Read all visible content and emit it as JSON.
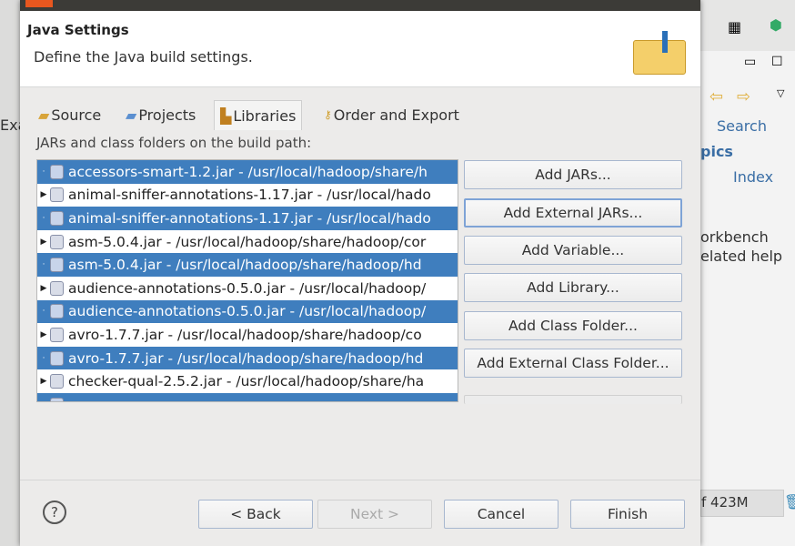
{
  "header": {
    "title": "Java Settings",
    "subtitle": "Define the Java build settings."
  },
  "tabs": [
    {
      "label": "Source"
    },
    {
      "label": "Projects"
    },
    {
      "label": "Libraries",
      "selected": true
    },
    {
      "label": "Order and Export"
    }
  ],
  "list_label": "JARs and class folders on the build path:",
  "entries": [
    {
      "text": "accessors-smart-1.2.jar - /usr/local/hadoop/share/h",
      "selected": true
    },
    {
      "text": "animal-sniffer-annotations-1.17.jar - /usr/local/hado",
      "selected": false
    },
    {
      "text": "animal-sniffer-annotations-1.17.jar - /usr/local/hado",
      "selected": true
    },
    {
      "text": "asm-5.0.4.jar - /usr/local/hadoop/share/hadoop/cor",
      "selected": false
    },
    {
      "text": "asm-5.0.4.jar - /usr/local/hadoop/share/hadoop/hd",
      "selected": true
    },
    {
      "text": "audience-annotations-0.5.0.jar - /usr/local/hadoop/",
      "selected": false
    },
    {
      "text": "audience-annotations-0.5.0.jar - /usr/local/hadoop/",
      "selected": true
    },
    {
      "text": "avro-1.7.7.jar - /usr/local/hadoop/share/hadoop/co",
      "selected": false
    },
    {
      "text": "avro-1.7.7.jar - /usr/local/hadoop/share/hadoop/hd",
      "selected": true
    },
    {
      "text": "checker-qual-2.5.2.jar - /usr/local/hadoop/share/ha",
      "selected": false
    },
    {
      "text": "",
      "selected": true
    }
  ],
  "side_buttons": [
    "Add JARs...",
    "Add External JARs...",
    "Add Variable...",
    "Add Library...",
    "Add Class Folder...",
    "Add External Class Folder..."
  ],
  "footer": {
    "back": "< Back",
    "next": "Next >",
    "cancel": "Cancel",
    "finish": "Finish",
    "help": "?"
  },
  "background": {
    "left_text": "Exa",
    "search": "Search",
    "topics": "pics",
    "index": "Index",
    "line1": "orkbench",
    "line2": "elated help",
    "memory": "f 423M"
  },
  "colors": {
    "selection": "#3f7ebe"
  }
}
